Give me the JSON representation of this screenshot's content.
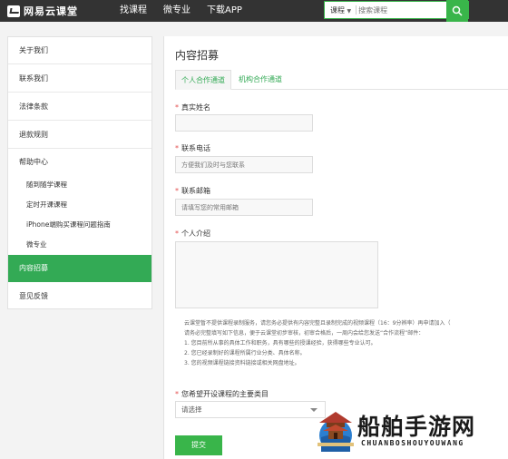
{
  "header": {
    "logo_text": "网易云课堂",
    "nav": [
      "找课程",
      "微专业",
      "下载APP"
    ],
    "search": {
      "category": "课程",
      "placeholder": "搜索课程"
    }
  },
  "sidebar": {
    "items": [
      {
        "label": "关于我们"
      },
      {
        "label": "联系我们"
      },
      {
        "label": "法律条款"
      },
      {
        "label": "退款规则"
      },
      {
        "label": "帮助中心"
      },
      {
        "label": "随到随学课程"
      },
      {
        "label": "定时开课课程"
      },
      {
        "label": "iPhone端购买课程问题指南"
      },
      {
        "label": "微专业"
      },
      {
        "label": "内容招募",
        "active": true
      },
      {
        "label": "意见反馈"
      }
    ]
  },
  "main": {
    "title": "内容招募",
    "tabs": [
      {
        "label": "个人合作通道",
        "active": true
      },
      {
        "label": "机构合作通道"
      }
    ],
    "form": {
      "name_label": "真实姓名",
      "name_value": "",
      "phone_label": "联系电话",
      "phone_placeholder": "方便我们及时与您联系",
      "email_label": "联系邮箱",
      "email_placeholder": "请填写您的常用邮箱",
      "intro_label": "个人介绍",
      "notice": [
        "云课堂暂不提供课程录制服务，请您务必提供有内容完整且录制完成的视频课程（16：9分辨率）再申请加入（",
        "请务必完整填写如下信息，便于云课堂初步审核，初审合格后，一周内会给您发送“合作流程”邮件：",
        "1. 您目前所从事的具体工作和职务，具有哪些的授课经验，获得哪些专业认可。",
        "2. 您已经录制好的课程所属行业分类、具体名称。",
        "3. 您的视频课程链接资料链接或相关网盘地址。"
      ],
      "category_label": "您希望开设课程的主要类目",
      "category_value": "请选择",
      "submit_label": "提交"
    }
  },
  "watermark": {
    "title": "船舶手游网",
    "subtitle": "CHUANBOSHOUYOUWANG"
  },
  "colors": {
    "accent": "#39b54a",
    "topbar": "#333333",
    "required": "#e45050"
  }
}
